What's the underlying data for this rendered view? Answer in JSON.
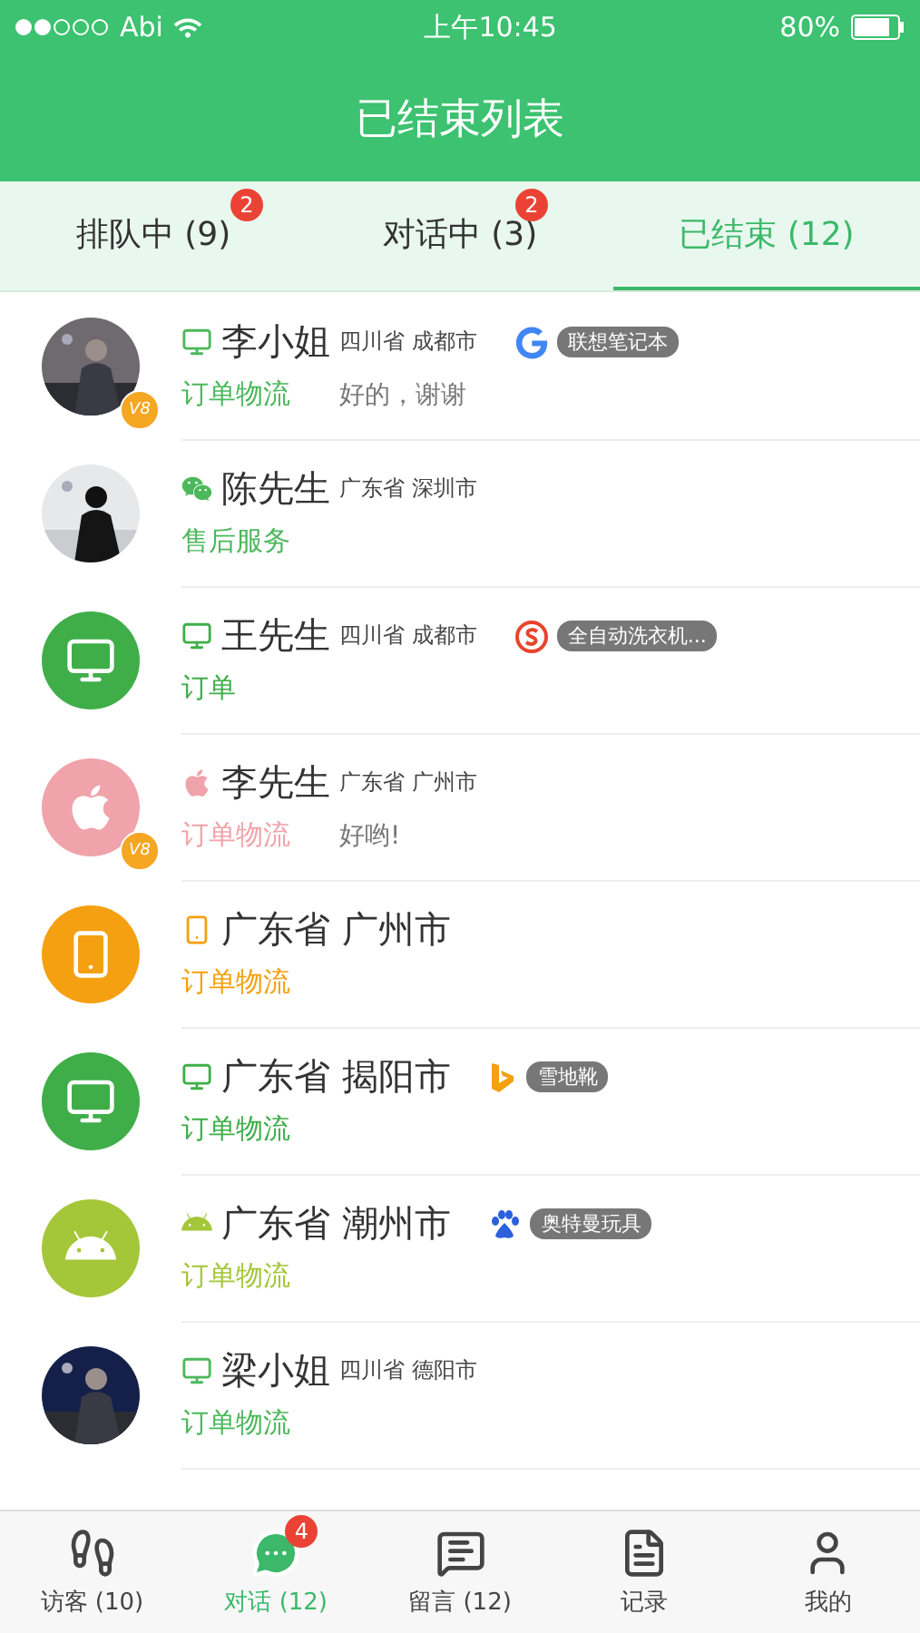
{
  "status_bar": {
    "carrier": "Abi",
    "time": "上午10:45",
    "battery": "80%"
  },
  "header": {
    "title": "已结束列表"
  },
  "tabs": [
    {
      "label": "排队中 (9)",
      "badge": "2",
      "selected": false
    },
    {
      "label": "对话中 (3)",
      "badge": "2",
      "selected": false
    },
    {
      "label": "已结束 (12)",
      "selected": true
    }
  ],
  "conversations": [
    {
      "name": "李小姐",
      "location": "四川省 成都市",
      "tag": "联想笔记本",
      "topic": "订单物流",
      "color": "#4cb85c",
      "message": "好的，谢谢",
      "vip": "V8"
    },
    {
      "name": "陈先生",
      "location": "广东省 深圳市",
      "topic": "售后服务",
      "color": "#4cb85c"
    },
    {
      "kind": "device",
      "name": "王先生",
      "location": "四川省 成都市",
      "tag": "全自动洗衣机...",
      "topic": "订单",
      "color": "#3fae49"
    },
    {
      "kind": "device",
      "name": "李先生",
      "location": "广东省 广州市",
      "topic": "订单物流",
      "color": "#f0a3aa",
      "message": "好哟!",
      "vip": "V8"
    },
    {
      "kind": "device",
      "name": "广东省 广州市",
      "topic": "订单物流",
      "color": "#f5a011"
    },
    {
      "kind": "device",
      "name": "广东省 揭阳市",
      "tag": "雪地靴",
      "topic": "订单物流",
      "color": "#3fae49"
    },
    {
      "kind": "device",
      "name": "广东省 潮州市",
      "tag": "奥特曼玩具",
      "topic": "订单物流",
      "color": "#a4c639"
    },
    {
      "name": "梁小姐",
      "location": "四川省 德阳市",
      "topic": "订单物流",
      "color": "#4cb85c"
    }
  ],
  "bottom_nav": [
    {
      "label": "访客 (10)",
      "selected": false
    },
    {
      "label": "对话 (12)",
      "badge": "4",
      "selected": true
    },
    {
      "label": "留言 (12)",
      "selected": false
    },
    {
      "label": "记录",
      "selected": false
    },
    {
      "label": "我的",
      "selected": false
    }
  ]
}
